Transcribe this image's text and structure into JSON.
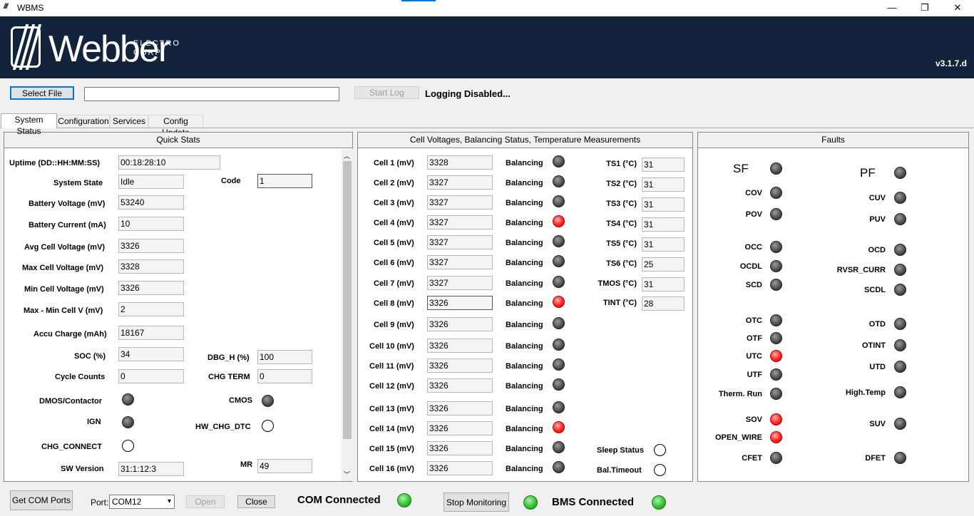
{
  "window": {
    "title": "WBMS",
    "min": "—",
    "max": "❐",
    "close": "✕",
    "app_icon": "webber-logo-icon"
  },
  "header": {
    "logo_text": "Webber",
    "logo_sub1": "ELECTRO",
    "logo_sub2": "CORP",
    "version": "v3.1.7.d",
    "bg_color": "#13233c"
  },
  "toolbar": {
    "select_file": "Select File",
    "file_path": "",
    "start_log": "Start Log",
    "logging_status": "Logging Disabled..."
  },
  "tabs": [
    {
      "label": "System Status",
      "active": true
    },
    {
      "label": "Configuration",
      "active": false
    },
    {
      "label": "Services",
      "active": false
    },
    {
      "label": "Config Update",
      "active": false
    }
  ],
  "quick_stats": {
    "title": "Quick Stats",
    "uptime": {
      "label": "Uptime (DD::HH:MM:SS)",
      "value": "00:18:28:10"
    },
    "system_state": {
      "label": "System State",
      "value": "Idle"
    },
    "code": {
      "label": "Code",
      "value": "1"
    },
    "battery_voltage": {
      "label": "Battery Voltage (mV)",
      "value": "53240"
    },
    "battery_current": {
      "label": "Battery Current (mA)",
      "value": "10"
    },
    "avg_cell_voltage": {
      "label": "Avg Cell Voltage (mV)",
      "value": "3326"
    },
    "max_cell_voltage": {
      "label": "Max Cell Voltage (mV)",
      "value": "3328"
    },
    "min_cell_voltage": {
      "label": "Min Cell Voltage (mV)",
      "value": "3326"
    },
    "max_min_cell_v": {
      "label": "Max - Min Cell V (mV)",
      "value": "2"
    },
    "accu_charge": {
      "label": "Accu Charge (mAh)",
      "value": "18167"
    },
    "soc": {
      "label": "SOC (%)",
      "value": "34"
    },
    "dbg_h": {
      "label": "DBG_H (%)",
      "value": "100"
    },
    "cycle_counts": {
      "label": "Cycle Counts",
      "value": "0"
    },
    "chg_term": {
      "label": "CHG TERM",
      "value": "0"
    },
    "dmos": {
      "label": "DMOS/Contactor",
      "state": "gray"
    },
    "cmos": {
      "label": "CMOS",
      "state": "gray"
    },
    "ign": {
      "label": "IGN",
      "state": "gray"
    },
    "hw_chg_dtc": {
      "label": "HW_CHG_DTC",
      "state": "off"
    },
    "chg_connect": {
      "label": "CHG_CONNECT",
      "state": "off"
    },
    "sw_version": {
      "label": "SW Version",
      "value": "31:1:12:3"
    },
    "mr": {
      "label": "MR",
      "value": "49"
    }
  },
  "cells": {
    "title": "Cell Voltages, Balancing Status, Temperature Measurements",
    "balancing_label": "Balancing",
    "list": [
      {
        "label": "Cell 1 (mV)",
        "value": "3328",
        "bal": "gray"
      },
      {
        "label": "Cell 2 (mV)",
        "value": "3327",
        "bal": "gray"
      },
      {
        "label": "Cell 3 (mV)",
        "value": "3327",
        "bal": "gray"
      },
      {
        "label": "Cell 4 (mV)",
        "value": "3327",
        "bal": "red"
      },
      {
        "label": "Cell 5 (mV)",
        "value": "3327",
        "bal": "gray"
      },
      {
        "label": "Cell 6 (mV)",
        "value": "3327",
        "bal": "gray"
      },
      {
        "label": "Cell 7 (mV)",
        "value": "3327",
        "bal": "gray"
      },
      {
        "label": "Cell 8 (mV)",
        "value": "3326",
        "bal": "red"
      },
      {
        "label": "Cell 9 (mV)",
        "value": "3326",
        "bal": "gray"
      },
      {
        "label": "Cell 10 (mV)",
        "value": "3326",
        "bal": "gray"
      },
      {
        "label": "Cell 11 (mV)",
        "value": "3326",
        "bal": "gray"
      },
      {
        "label": "Cell 12 (mV)",
        "value": "3326",
        "bal": "gray"
      },
      {
        "label": "Cell 13 (mV)",
        "value": "3326",
        "bal": "gray"
      },
      {
        "label": "Cell 14 (mV)",
        "value": "3326",
        "bal": "red"
      },
      {
        "label": "Cell 15 (mV)",
        "value": "3326",
        "bal": "gray"
      },
      {
        "label": "Cell 16 (mV)",
        "value": "3326",
        "bal": "gray"
      }
    ],
    "temps": [
      {
        "label": "TS1 (°C)",
        "value": "31"
      },
      {
        "label": "TS2 (°C)",
        "value": "31"
      },
      {
        "label": "TS3 (°C)",
        "value": "31"
      },
      {
        "label": "TS4 (°C)",
        "value": "31"
      },
      {
        "label": "TS5 (°C)",
        "value": "31"
      },
      {
        "label": "TS6 (°C)",
        "value": "25"
      },
      {
        "label": "TMOS (°C)",
        "value": "31"
      },
      {
        "label": "TINT (°C)",
        "value": "28"
      }
    ],
    "sleep_status": {
      "label": "Sleep Status",
      "state": "off"
    },
    "bal_timeout": {
      "label": "Bal.Timeout",
      "state": "off"
    }
  },
  "faults": {
    "title": "Faults",
    "left": [
      {
        "label": "SF",
        "state": "gray",
        "big": true
      },
      {
        "label": "COV",
        "state": "gray"
      },
      {
        "label": "POV",
        "state": "gray"
      },
      {
        "label": "OCC",
        "state": "gray"
      },
      {
        "label": "OCDL",
        "state": "gray"
      },
      {
        "label": "SCD",
        "state": "gray"
      },
      {
        "label": "OTC",
        "state": "gray"
      },
      {
        "label": "OTF",
        "state": "gray"
      },
      {
        "label": "UTC",
        "state": "red"
      },
      {
        "label": "UTF",
        "state": "gray"
      },
      {
        "label": "Therm. Run",
        "state": "gray"
      },
      {
        "label": "SOV",
        "state": "red"
      },
      {
        "label": "OPEN_WIRE",
        "state": "red"
      },
      {
        "label": "CFET",
        "state": "gray"
      }
    ],
    "right": [
      {
        "label": "PF",
        "state": "gray",
        "big": true
      },
      {
        "label": "CUV",
        "state": "gray"
      },
      {
        "label": "PUV",
        "state": "gray"
      },
      {
        "label": "OCD",
        "state": "gray"
      },
      {
        "label": "RVSR_CURR",
        "state": "gray"
      },
      {
        "label": "SCDL",
        "state": "gray"
      },
      {
        "label": "OTD",
        "state": "gray"
      },
      {
        "label": "OTINT",
        "state": "gray"
      },
      {
        "label": "UTD",
        "state": "gray"
      },
      {
        "label": "High.Temp",
        "state": "gray"
      },
      {
        "label": "SUV",
        "state": "gray"
      },
      {
        "label": "DFET",
        "state": "gray"
      }
    ]
  },
  "bottom": {
    "get_com_ports": "Get COM Ports",
    "port_label": "Port:",
    "port_value": "COM12",
    "open": "Open",
    "close": "Close",
    "com_connected": "COM Connected",
    "com_state": "green",
    "stop_monitoring": "Stop Monitoring",
    "monitor_state": "green",
    "bms_connected": "BMS Connected",
    "bms_state": "green"
  }
}
